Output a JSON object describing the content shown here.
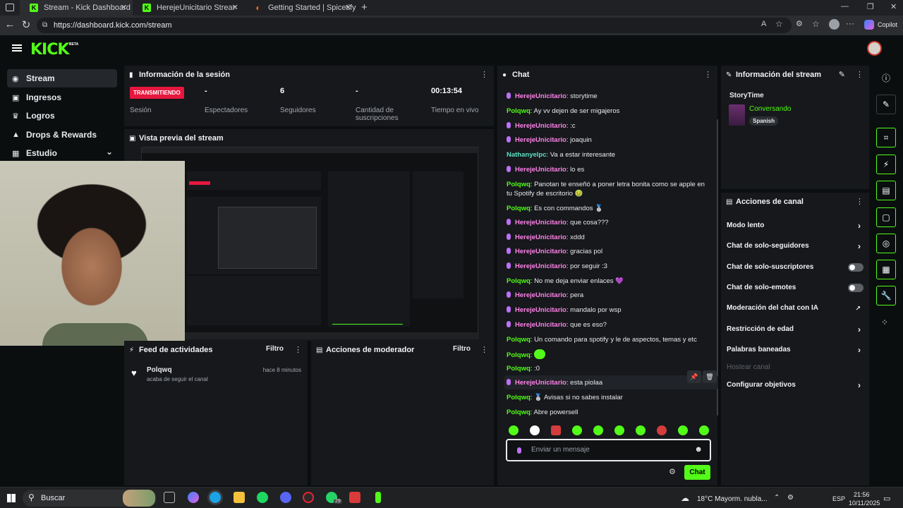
{
  "browser": {
    "tabs": [
      {
        "label": "Stream - Kick Dashboard",
        "favicon": "kick-icon"
      },
      {
        "label": "HerejeUnicitario Stream - Watch L",
        "favicon": "kick-icon"
      },
      {
        "label": "Getting Started | Spicetify",
        "favicon": "spicetify-icon"
      }
    ],
    "url": "https://dashboard.kick.com/stream",
    "copilot_label": "Copilot"
  },
  "app": {
    "logo": "KICK",
    "logo_badge": "BETA",
    "accent": "#53fc18"
  },
  "sidebar": {
    "items": [
      {
        "label": "Stream",
        "icon": "broadcast-icon"
      },
      {
        "label": "Ingresos",
        "icon": "money-icon"
      },
      {
        "label": "Logros",
        "icon": "trophy-icon"
      },
      {
        "label": "Drops & Rewards",
        "icon": "gift-icon"
      },
      {
        "label": "Estudio",
        "icon": "studio-icon"
      }
    ]
  },
  "session": {
    "title": "Información de la sesión",
    "status": "TRANSMITIENDO",
    "status_label": "Sesión",
    "spectators_value": "-",
    "spectators_label": "Espectadores",
    "followers_value": "6",
    "followers_label": "Seguidores",
    "subs_value": "-",
    "subs_label": "Cantidad de suscripciones",
    "live_time_value": "00:13:54",
    "live_time_label": "Tiempo en vivo"
  },
  "preview": {
    "title": "Vista previa del stream"
  },
  "activity": {
    "title": "Feed de actividades",
    "filter": "Filtro",
    "items": [
      {
        "user": "Polqwq",
        "text": "acaba de seguir el canal",
        "time": "hace 8 minutos"
      }
    ]
  },
  "mod_actions": {
    "title": "Acciones de moderador",
    "filter": "Filtro"
  },
  "chat": {
    "title": "Chat",
    "messages": [
      {
        "user": "HerejeUnicitario",
        "text": "storytime"
      },
      {
        "user": "Polqwq",
        "text": "Ay vv dejen de ser migajeros"
      },
      {
        "user": "HerejeUnicitario",
        "text": ":c"
      },
      {
        "user": "HerejeUnicitario",
        "text": "joaquin"
      },
      {
        "user": "Nathanyelpc",
        "text": "Va a estar interesante"
      },
      {
        "user": "HerejeUnicitario",
        "text": "lo es"
      },
      {
        "user": "Polqwq",
        "text": "Panotan te enseñó a poner letra bonita como se apple en tu Spotify de escritorio 🤢"
      },
      {
        "user": "Polqwq",
        "text": "Es con commandos 🥈"
      },
      {
        "user": "HerejeUnicitario",
        "text": "que cosa???"
      },
      {
        "user": "HerejeUnicitario",
        "text": "xddd"
      },
      {
        "user": "HerejeUnicitario",
        "text": "gracias pol"
      },
      {
        "user": "HerejeUnicitario",
        "text": "por seguir :3"
      },
      {
        "user": "Polqwq",
        "text": "No me deja enviar enlaces 💜"
      },
      {
        "user": "HerejeUnicitario",
        "text": "pera"
      },
      {
        "user": "HerejeUnicitario",
        "text": "mandalo por wsp"
      },
      {
        "user": "HerejeUnicitario",
        "text": "que es eso?"
      },
      {
        "user": "Polqwq",
        "text": "Un comando para spotify y le de aspectos, temas y etc"
      },
      {
        "user": "Polqwq",
        "text": ""
      },
      {
        "user": "Polqwq",
        "text": ":0"
      },
      {
        "user": "HerejeUnicitario",
        "text": "esta piolaa"
      },
      {
        "user": "Polqwq",
        "text": "🥈 Avisas si no sabes instalar"
      },
      {
        "user": "Polqwq",
        "text": "Abre powersell"
      }
    ],
    "input_placeholder": "Enviar un mensaje",
    "send_label": "Chat"
  },
  "stream_info": {
    "title": "Información del stream",
    "stream_title": "StoryTime",
    "category": "Conversando",
    "language": "Spanish"
  },
  "channel_actions": {
    "title": "Acciones de canal",
    "items": [
      {
        "label": "Modo lento",
        "control": "chevron"
      },
      {
        "label": "Chat de solo-seguidores",
        "control": "chevron"
      },
      {
        "label": "Chat de solo-suscriptores",
        "control": "toggle"
      },
      {
        "label": "Chat de solo-emotes",
        "control": "toggle"
      },
      {
        "label": "Moderación del chat con IA",
        "control": "external"
      },
      {
        "label": "Restricción de edad",
        "control": "chevron"
      },
      {
        "label": "Palabras baneadas",
        "control": "chevron"
      },
      {
        "label": "Hostear canal",
        "control": "none"
      },
      {
        "label": "Configurar objetivos",
        "control": "chevron"
      }
    ]
  },
  "taskbar": {
    "search": "Buscar",
    "weather": "18°C  Mayorm. nubla...",
    "lang": "ESP",
    "time": "21:56",
    "date": "10/11/2025",
    "badge_count": "29"
  }
}
